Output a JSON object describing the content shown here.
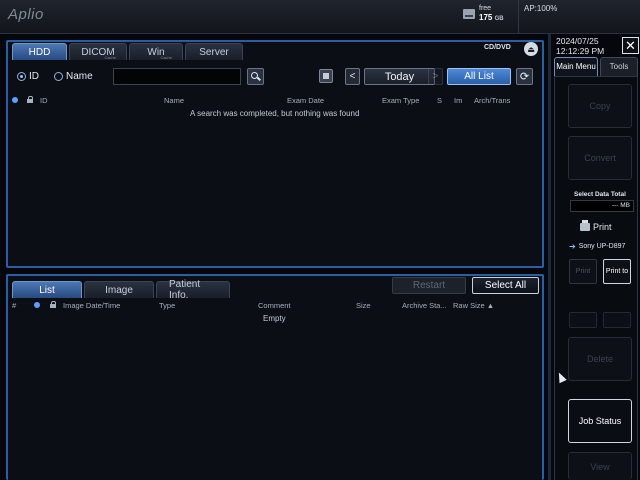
{
  "app": {
    "brand": "Aplio"
  },
  "status": {
    "storage_label": "free",
    "storage_value": "175",
    "storage_unit": "GB",
    "ap": "AP:100%"
  },
  "hdd_panel": {
    "tabs": [
      {
        "label": "HDD",
        "sub": ""
      },
      {
        "label": "DICOM",
        "sub": "Cache"
      },
      {
        "label": "Win",
        "sub": "Cache"
      },
      {
        "label": "Server",
        "sub": ""
      }
    ],
    "cd_dvd": "CD/DVD",
    "search": {
      "radio_id": "ID",
      "radio_name": "Name",
      "input_value": "",
      "prev": "<",
      "today": "Today",
      "next": ">",
      "all_list": "All List"
    },
    "columns": [
      "ID",
      "Name",
      "Exam Date",
      "Exam Type",
      "S",
      "Im",
      "Arch/Trans"
    ],
    "message": "A search was completed, but nothing was found"
  },
  "list_panel": {
    "tabs": [
      "List",
      "Image",
      "Patient Info."
    ],
    "restart": "Restart",
    "select_all": "Select All",
    "columns": [
      "#",
      "Image Date/Time",
      "Type",
      "Comment",
      "Size",
      "Archive Sta...",
      "Raw Size ▲"
    ],
    "empty": "Empty"
  },
  "side": {
    "date": "2024/07/25",
    "time": "12:12:29 PM",
    "tabs": [
      "Main Menu",
      "Tools"
    ],
    "copy": "Copy",
    "convert": "Convert",
    "select_data_total_label": "Select Data Total",
    "select_data_total_value": "--- MB",
    "print_label": "Print",
    "printer_device": "Sony UP-D897",
    "print_btn": "Print",
    "print_to_btn": "Print to",
    "delete": "Delete",
    "job_status": "Job Status",
    "view": "View"
  },
  "colors": {
    "accent": "#2b5fa4",
    "active_button": "#3a74c4",
    "background": "#05070c"
  }
}
